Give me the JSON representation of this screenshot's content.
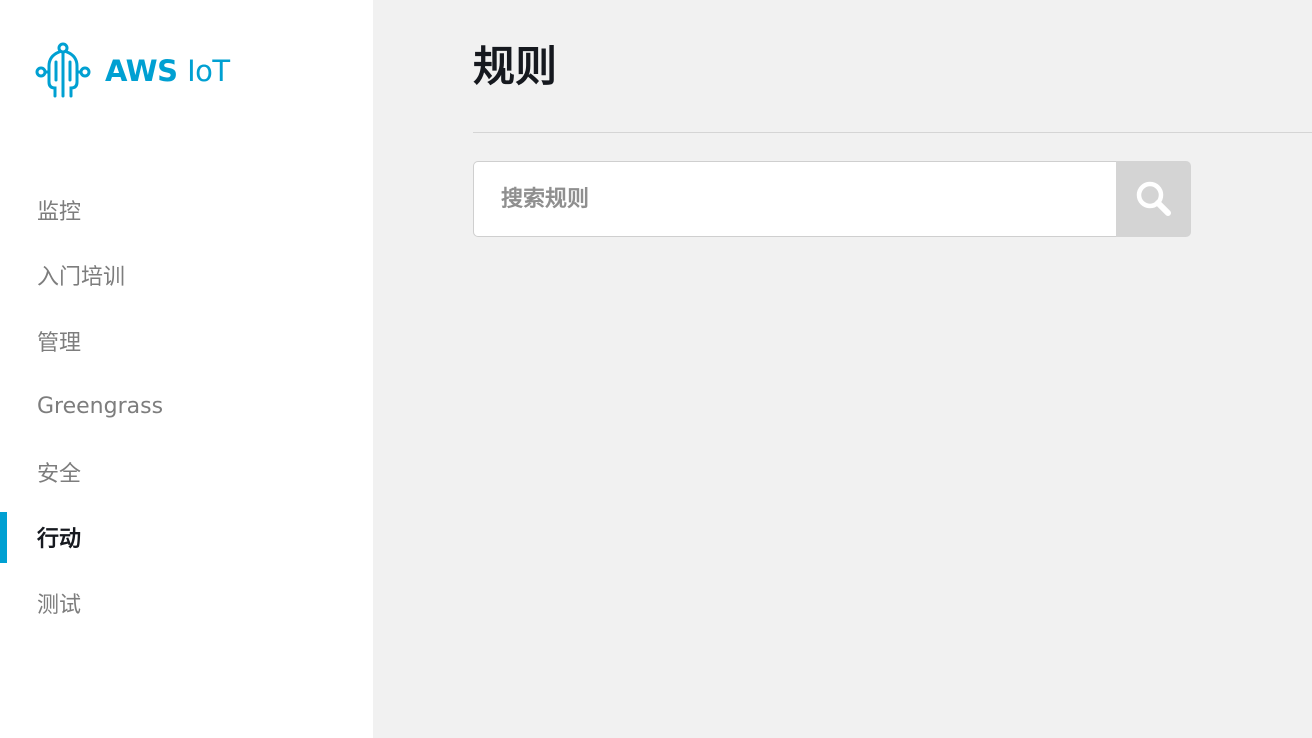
{
  "brand": {
    "name_bold": "AWS",
    "name_light": "IoT",
    "accent_color": "#00a0d2",
    "icon": "aws-iot-logo-icon"
  },
  "sidebar": {
    "items": [
      {
        "label": "监控",
        "active": false
      },
      {
        "label": "入门培训",
        "active": false
      },
      {
        "label": "管理",
        "active": false
      },
      {
        "label": "Greengrass",
        "active": false
      },
      {
        "label": "安全",
        "active": false
      },
      {
        "label": "行动",
        "active": true
      },
      {
        "label": "测试",
        "active": false
      }
    ]
  },
  "main": {
    "title": "规则",
    "search": {
      "placeholder": "搜索规则",
      "value": "",
      "button_icon": "search-icon"
    }
  }
}
